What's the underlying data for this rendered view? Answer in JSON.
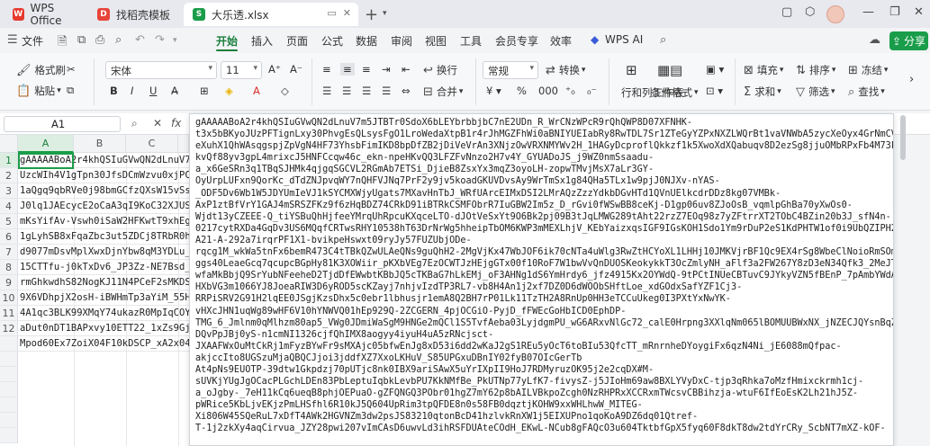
{
  "titlebar": {
    "tabs": [
      {
        "label": "WPS Office",
        "icon": "wps-logo-icon",
        "color": "#e63a2e"
      },
      {
        "label": "找稻壳模板",
        "icon": "docer-icon",
        "color": "#e8443a"
      },
      {
        "label": "大乐透.xlsx",
        "icon": "spreadsheet-icon",
        "color": "#1a9d4a"
      }
    ]
  },
  "menubar": {
    "file": "文件",
    "items": [
      "开始",
      "插入",
      "页面",
      "公式",
      "数据",
      "审阅",
      "视图",
      "工具",
      "会员专享",
      "效率"
    ],
    "active": "开始",
    "wps_ai": "WPS AI",
    "share": "分享"
  },
  "ribbon": {
    "format_painter": "格式刷",
    "paste": "粘贴",
    "font_name": "宋体",
    "font_size": "11",
    "wrap": "换行",
    "merge": "合并",
    "number_format": "常规",
    "convert": "转换",
    "rowcol": "行和列",
    "worksheet": "工作表",
    "cond_format": "条件格式",
    "fill": "填充",
    "sort": "排序",
    "freeze": "冻结",
    "sum": "求和",
    "filter": "筛选",
    "find": "查找"
  },
  "formula_bar": {
    "name_box": "A1"
  },
  "grid": {
    "columns": [
      "A",
      "B",
      "C"
    ],
    "rows": [
      "1",
      "2",
      "3",
      "4",
      "5",
      "6",
      "7",
      "8",
      "9",
      "10",
      "11",
      "12"
    ],
    "cells": [
      "gAAAAABoA2r4khQSIuGVwQN2dLnuV7m",
      "UzcWIh4V1gTpn30JfsDCmWzvu0xjPCf",
      "1aQgq9qbRVe0j98bmGCfzQXsW15vSsEr",
      "J0lq1JAEcycE2oCaA3qI9KoC32XJUSS",
      "mKsYifAv-Vswh0iSaW2HFKwtT9xhEg4",
      "1gLyhSB8xFqaZbc3ut5ZDCj8TRbR0h0",
      "d9077mDsvMplXwxDjnYbw8qM3YDLu_f",
      "15CTTfu-j0kTxDv6_JP3Zz-NE7Bsd_V",
      "rmGhkwdhS82NogKJ11N4PCeF2sMKDS8",
      "9X6VDhpjX2osH-iBWHmTp3aYiM_55HN",
      "4A1qc3BLK99XMqY74ukazR0MpIqCOY2",
      "aDut0nDT1BAPxvy10ETT22_1xZs9GjD",
      "Mpod60Ex7ZoiX04F10kDSCP_xA2x04p"
    ]
  },
  "formula_content": [
    "gAAAAABoA2r4khQSIuGVwQN2dLnuV7m5JTBTr0SdoX6bLEYbrbbjbC7nE2UDn_R_WrCNzWPcR9rQhQWP8D07XFNHK-",
    "t3x5bBKyoJUzPFTignLxy30PhvgEsQLsysFgO1LroWedaXtpB1r4rJhMGZFhWi0aBNIYUEIabRy8RwTDL7Sr1ZTeGyYZPxNXZLWQrBt1vaVNWbA5zycXeOyx4GrNmCVZ",
    "eXuhX1QhWAsqgspjZpVgN4HF73YhsbFimIKD8bpDfZB2jDiVeVrAn3XNjzOwVRXNMYWv2H_1HAGyDcproflQkkzf1k5XwoXdXQabuqv8D2ezSg8jjuOMbRPxFb4M73F",
    "kvQf88yv3gpL4mrixcJ5HNFCcqw46c_ekn-npeHKvQQ3LFZFvNnzo2H7v4Y_GYUADoJS_j9WZ0nmSsaadu-",
    "a_x6GeSRn3q1TBqSJHMk4qjgqSGCVL2RGmAb7ETSi_DjieB8ZsxYx3mqZ3oyoLH-zopwTMvjMsX7aLr3GY-",
    "OyUrpLUFxn9QorKc_dTdZNJpvqWY7nQHFVJNq7PrF2y9jv5koadGKUVDvsAy9WrTmSx1g84QHa5TLx1w9pjJ0NJXv-nYAS-",
    "_ODF5Dv6Wb1W5JDYUmIeVJ1kSYCMXWjyUgats7MXavHnTbJ_WRfUArcEIMxDSI2LMrAQzZzzYdkbDGvHTd1QVnUElkcdrDDz8kg07VMBk-",
    "AxP1ztBfVrY1GAJ4mSRSZFKz9f6zHqBDZ74CRkD91iBTRkCSMFObrR7IuGBW2Im5z_D_rGvi0fWSwBB8ceKj-D1gp06uv8ZJoOsB_vqmlpGhBa70yXwOs0-",
    "Wjdt13yCZEEE-Q_tiYSBuQhHjfeeYMrqUhRpcuKXqceLTO-dJOtVeSxYt9O6Bk2pj09B3tJqLMWG289tAht22rzZ7EOq98z7yZFtrrXT2TObC4BZin20b3J_sfN4n-",
    "0217cytRXDa4GqDv3US6MQqfCRTwsRHY10538hT63DrNrWg5hheipTbOM6KWP3mMEXLhjV_KEbYaizxqsIGF9IGsKOH1Sdo1Ym9rDuP2eS1KdPHTW1of0i9UbQZIPH2C",
    "A21-A-292a7irqrPF1X1-bvikpeHswxt09ryJy57FUZUbjODe-",
    "rqcg1M_wkWa5tnFx6bemR473C4tTBkQZwULAeQNs9guQhH2-2MgVjKx47WbJOF6ik70cNTa4uWlg3RwZtHCYoXL1LHHj10JMKVjrBF1Qc9EX4rSg8WbeClNoioRmSOm",
    "ggs40LeaeGcq7qcupcBGpHy81K3XOWiir_pKXbVEg7EzOCWTJzHEjgGTx00f10RoF7W1bwVvQnDUOSKeokykkT3OcZmlyNH_aFlf3a2FW267Y8zD3eN34Qfk3_2MeJTh",
    "wfaMkBbjQ9SrYubNFeeheD2TjdDfEWwbtKBbJQ5cTKBaG7hLkEMj_oF3AHNg1dS6YmHrdy6_jfz4915Kx2OYWdQ-9tPCtINUeCBTuvC9JYkyVZN5fBEnP_7pAmbYWdAc",
    "HXbVG3m1066YJ8JoeaRIW3D6yROD5scKZayj7nhjvIzdTP3RL7-vb8H4An1j2xf7DZ0D6dWOObSHftLoe_xdGOdxSafYZF1Cj3-",
    "RRPiSRV2G91H2lqEE0JSgjKzsDhx5c0ebr1lbhusjr1emA8Q2BH7rP01Lk11TzTH2A8RnUp0HH3eTCCuUkeg0I3PXtYxNwYK-",
    "vHXcJHN1uqWg89wHF6V10hYNWVQ01hEp929Q-2ZCGERN_4pjOCGiO-PyjD_fFWEcGoHbICD0EphDP-",
    "TMG_6_Jmlnm0qMlhzm80ap5_VWg0JDmiWaSgM9HNGe2mQCl1S5TvfAeba03LyjdgmPU_wG6ARxvNlGc72_calE0Hrpng3XXlqNm065lBOMUUBWxNX_jNZECJQYsnBqZf2Gk",
    "DQvPpJBj0yS-n1cmNI1326cjfQhIMX8aogyy4iyuH4uA5zRNcjsct-",
    "JXAAFWxOuMtCkRj1mFyzBYwFr9sMXAjc05bfwEnJg8xD53i6dd2wKaJ2gS1REu5yOcT6toBIu53QfcTT_mRnrnheDYoygiFx6qzN4Ni_jE6088mQfpac-",
    "akjccIto8UGSzuMjaQBQCJjoi3jddfXZ7XxoLKHuV_S85UPGxuDBnIY02fyB07OIcGerTb",
    "At4pNs9EUOTP-39dtw1Gkpdzj70pUTjc8nk0IBX9ariSAwX5uYrIXpII9HoJ7RDMyruzOK95j2e2cqDX#M-",
    "sUVKjYUgJgOCacPLGchLDEn83PbLeptuIqbkLevbPU7KkNMfBe_PkUTNp77yLfK7-fivysZ-j5JIoHm69aw8BXLYVyDxC-tjp3qRhka7oMzfHmixckrmh1cj-",
    "a_oJgby-_7eH11kCq6ueqB8phjOEPuaO-gZFQNGQ3PObr01hgZ7mY62p8bAILVBkpoZcgh0NzRHPRxXCCRxmTWcsvCBBihzja-wtuF6IfEoEsK2Lh21hJ5Z-",
    "pWRice5KbLjvEKjzPmLHSfhl6R10kJ5Q604UpRim3tpQFDE8n0s58FB0dqztjKOHW9xxWHLhwW_MITEG-",
    "Xi806W45SQeRuL7xDfT4AWk2HGVNZm3dw2psJS83210qtonBcD41hzlvkRnXW1j5EIXUPno1qoKoA9DZ6dq01Qtref-",
    "T-1j2zkXy4aqCirvua_JZY28pwi207vImCAsD6uwvLd3ihRSFDUAteCOdH_EKwL-NCub8gFAQcO3u604TktbfGpX5fyq60F8dkT8dw2tdYrCRy_ScbNT7mXZ-kOF-"
  ]
}
